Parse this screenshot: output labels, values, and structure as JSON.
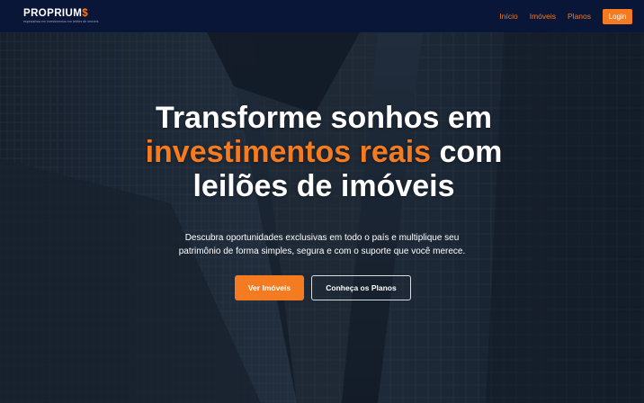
{
  "brand": {
    "name_main": "PROPRIUM",
    "name_accent": "$",
    "tagline": "especialista em investimentos em leilões de imóveis"
  },
  "nav": {
    "items": [
      {
        "label": "Início"
      },
      {
        "label": "Imóveis"
      },
      {
        "label": "Planos"
      }
    ],
    "login_label": "Login"
  },
  "hero": {
    "title_part1": "Transforme sonhos em ",
    "title_highlight": "investimentos reais",
    "title_part2": " com leilões de imóveis",
    "subtitle_line1": "Descubra oportunidades exclusivas em todo o país e multiplique seu",
    "subtitle_line2": "patrimônio de forma simples, segura e com o suporte que você merece.",
    "primary_button": "Ver Imóveis",
    "secondary_button": "Conheça os Planos",
    "background_image": "low-angle-skyscrapers-icon"
  },
  "colors": {
    "accent": "#f47b20",
    "navbar": "#0a1638",
    "text": "#ffffff"
  }
}
